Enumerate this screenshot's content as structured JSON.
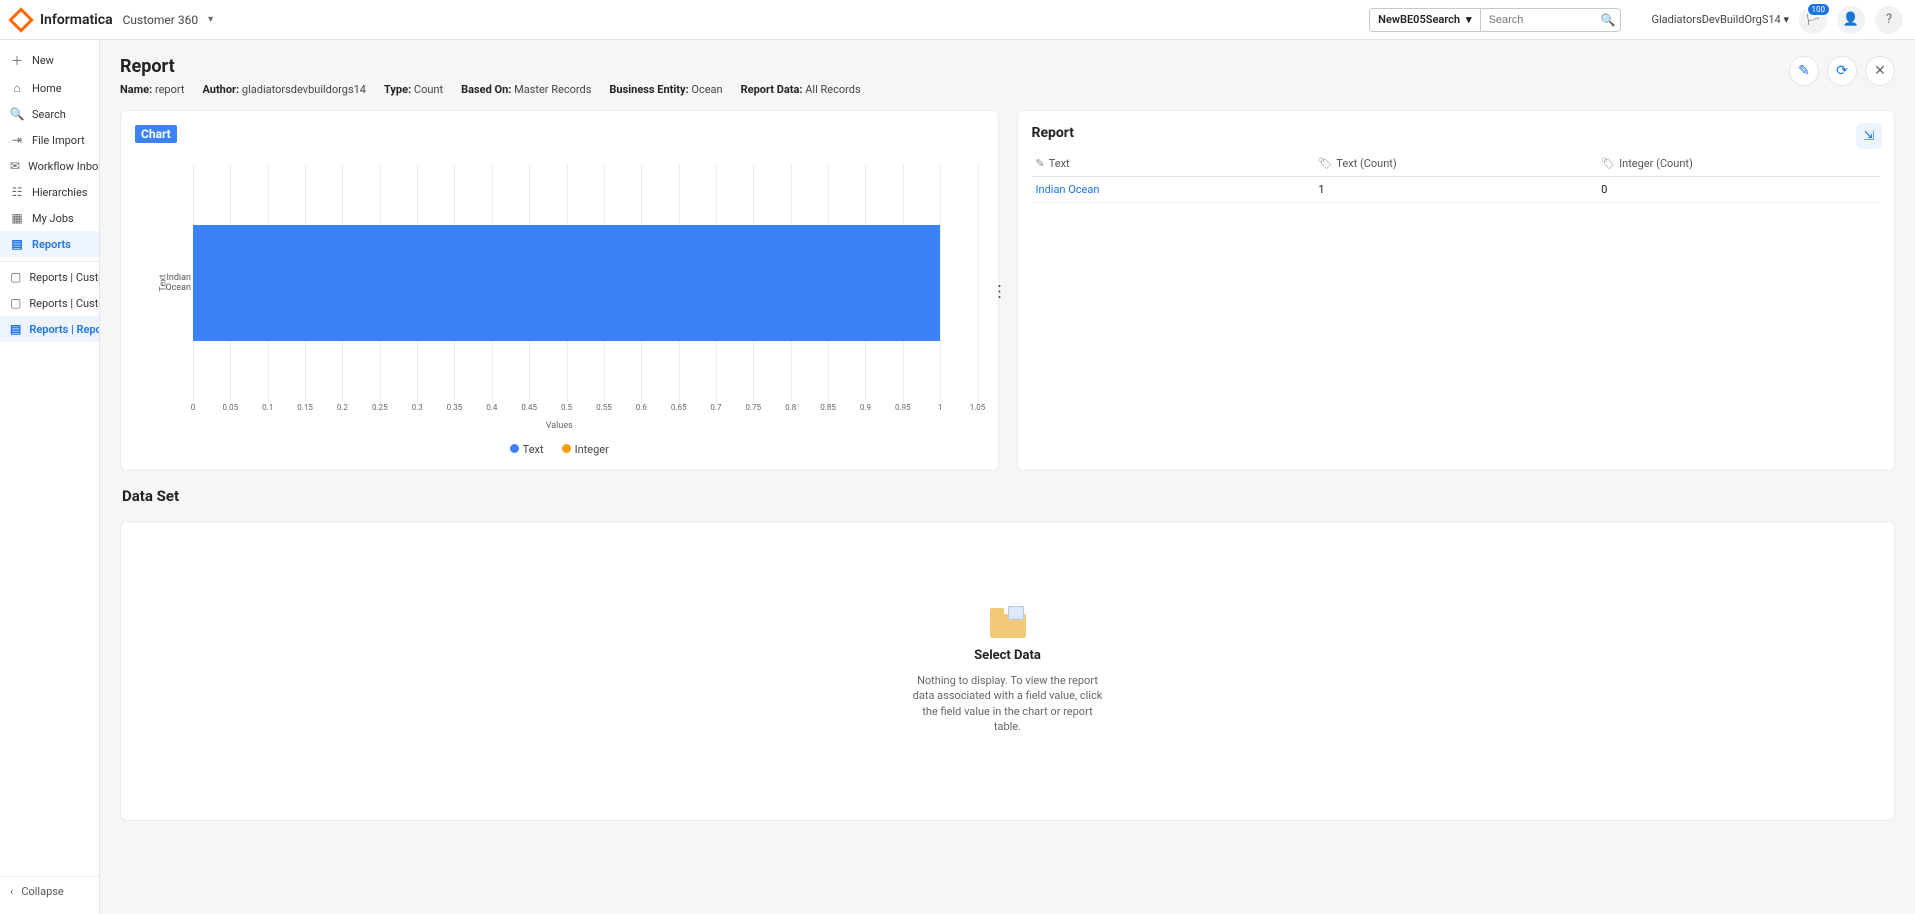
{
  "header": {
    "brand": "Informatica",
    "app": "Customer 360",
    "be_select": "NewBE05Search",
    "search_placeholder": "Search",
    "org": "GladiatorsDevBuildOrgS14",
    "notification_count": "100"
  },
  "sidebar": {
    "items": [
      {
        "label": "New"
      },
      {
        "label": "Home"
      },
      {
        "label": "Search"
      },
      {
        "label": "File Import"
      },
      {
        "label": "Workflow Inbox"
      },
      {
        "label": "Hierarchies"
      },
      {
        "label": "My Jobs"
      },
      {
        "label": "Reports",
        "active": true
      },
      {
        "label": "Reports | Custom..."
      },
      {
        "label": "Reports | Custom..."
      },
      {
        "label": "Reports | Report",
        "subactive": true
      }
    ],
    "collapse": "Collapse"
  },
  "page": {
    "title": "Report",
    "meta": {
      "name_label": "Name:",
      "name_value": "report",
      "author_label": "Author:",
      "author_value": "gladiatorsdevbuildorgs14",
      "type_label": "Type:",
      "type_value": "Count",
      "based_label": "Based On:",
      "based_value": "Master Records",
      "entity_label": "Business Entity:",
      "entity_value": "Ocean",
      "data_label": "Report Data:",
      "data_value": "All Records"
    }
  },
  "chart_panel": {
    "badge": "Chart",
    "y_axis_title": "Text",
    "x_axis_title": "Values"
  },
  "chart_data": {
    "type": "bar",
    "orientation": "horizontal",
    "categories": [
      "Indian Ocean"
    ],
    "series": [
      {
        "name": "Text",
        "values": [
          1
        ],
        "color": "#3b82f6"
      },
      {
        "name": "Integer",
        "values": [
          0
        ],
        "color": "#f59e0b"
      }
    ],
    "xlabel": "Values",
    "ylabel": "Text",
    "xlim": [
      0,
      1.05
    ],
    "ticks": [
      0,
      0.05,
      0.1,
      0.15,
      0.2,
      0.25,
      0.3,
      0.35,
      0.4,
      0.45,
      0.5,
      0.55,
      0.6,
      0.65,
      0.7,
      0.75,
      0.8,
      0.85,
      0.9,
      0.95,
      1,
      1.05
    ],
    "legend": [
      "Text",
      "Integer"
    ]
  },
  "report_table": {
    "title": "Report",
    "columns": [
      "Text",
      "Text (Count)",
      "Integer (Count)"
    ],
    "rows": [
      {
        "text": "Indian Ocean",
        "text_count": "1",
        "int_count": "0"
      }
    ]
  },
  "dataset": {
    "section_title": "Data Set",
    "title": "Select Data",
    "subtitle": "Nothing to display. To view the report data associated with a field value, click the field value in the chart or report table."
  }
}
